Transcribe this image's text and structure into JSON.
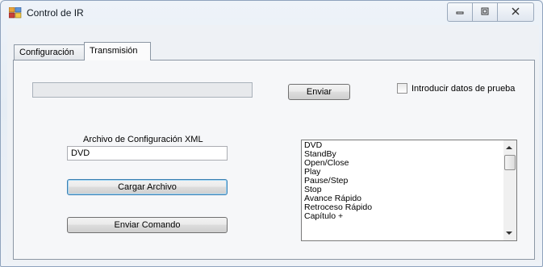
{
  "window": {
    "title": "Control de IR",
    "controls": {
      "minimize_icon": "minimize-icon",
      "maximize_icon": "maximize-icon",
      "close_icon": "close-icon"
    }
  },
  "tabs": [
    {
      "label": "Configuración",
      "active": false
    },
    {
      "label": "Transmisión",
      "active": true
    }
  ],
  "transmission": {
    "progress_value": 0,
    "send_button": "Enviar",
    "test_data_checkbox": {
      "label": "Introducir datos de prueba",
      "checked": false
    },
    "xml_label": "Archivo de Configuración XML",
    "xml_value": "DVD",
    "load_button": "Cargar Archivo",
    "send_command_button": "Enviar Comando",
    "commands": [
      "DVD",
      "StandBy",
      "Open/Close",
      "Play",
      "Pause/Step",
      "Stop",
      "Avance Rápido",
      "Retroceso Rápido",
      "Capítulo +"
    ]
  },
  "colors": {
    "accent": "#3c7fb1",
    "border": "#8c97a4"
  }
}
